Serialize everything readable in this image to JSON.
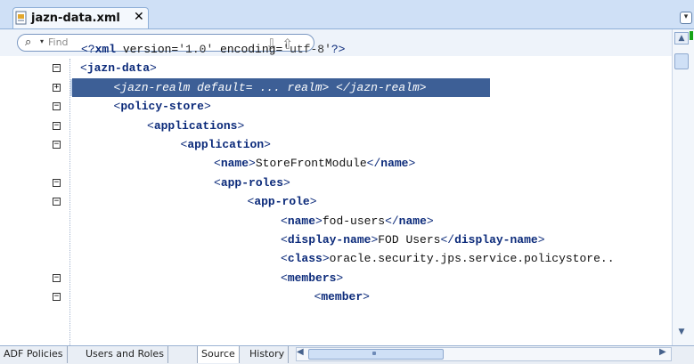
{
  "tab": {
    "title": "jazn-data.xml",
    "close": "✕",
    "file_icon": "xml-file-icon"
  },
  "search": {
    "placeholder": "Find",
    "binocular": "binoculars-icon"
  },
  "editor": {
    "lines": [
      {
        "fold": "",
        "parts": [
          [
            "pun",
            "<?"
          ],
          [
            "tag",
            "xml"
          ],
          [
            "val",
            " version="
          ],
          [
            "str",
            "'1.0'"
          ],
          [
            "val",
            " encoding="
          ],
          [
            "str",
            "'utf-8'"
          ],
          [
            "pun",
            "?>"
          ]
        ]
      },
      {
        "fold": "−",
        "parts": [
          [
            "pun",
            "<"
          ],
          [
            "tag",
            "jazn-data"
          ],
          [
            "pun",
            ">"
          ]
        ]
      },
      {
        "fold": "+",
        "parts": [
          [
            "hl",
            "<jazn-realm default= ... realm> </jazn-realm>"
          ]
        ]
      },
      {
        "fold": "−",
        "parts": [
          [
            "pun",
            "<"
          ],
          [
            "tag",
            "policy-store"
          ],
          [
            "pun",
            ">"
          ]
        ]
      },
      {
        "fold": "−",
        "parts": [
          [
            "pun",
            "<"
          ],
          [
            "tag",
            "applications"
          ],
          [
            "pun",
            ">"
          ]
        ]
      },
      {
        "fold": "−",
        "parts": [
          [
            "pun",
            "<"
          ],
          [
            "tag",
            "application"
          ],
          [
            "pun",
            ">"
          ]
        ]
      },
      {
        "fold": "",
        "parts": [
          [
            "pun",
            "<"
          ],
          [
            "tag",
            "name"
          ],
          [
            "pun",
            ">"
          ],
          [
            "val",
            "StoreFrontModule"
          ],
          [
            "pun",
            "</"
          ],
          [
            "tag",
            "name"
          ],
          [
            "pun",
            ">"
          ]
        ]
      },
      {
        "fold": "−",
        "parts": [
          [
            "pun",
            "<"
          ],
          [
            "tag",
            "app-roles"
          ],
          [
            "pun",
            ">"
          ]
        ]
      },
      {
        "fold": "−",
        "parts": [
          [
            "pun",
            "<"
          ],
          [
            "tag",
            "app-role"
          ],
          [
            "pun",
            ">"
          ]
        ]
      },
      {
        "fold": "",
        "parts": [
          [
            "pun",
            "<"
          ],
          [
            "tag",
            "name"
          ],
          [
            "pun",
            ">"
          ],
          [
            "val",
            "fod-users"
          ],
          [
            "pun",
            "</"
          ],
          [
            "tag",
            "name"
          ],
          [
            "pun",
            ">"
          ]
        ]
      },
      {
        "fold": "",
        "parts": [
          [
            "pun",
            "<"
          ],
          [
            "tag",
            "display-name"
          ],
          [
            "pun",
            ">"
          ],
          [
            "val",
            "FOD Users"
          ],
          [
            "pun",
            "</"
          ],
          [
            "tag",
            "display-name"
          ],
          [
            "pun",
            ">"
          ]
        ]
      },
      {
        "fold": "",
        "parts": [
          [
            "pun",
            "<"
          ],
          [
            "tag",
            "class"
          ],
          [
            "pun",
            ">"
          ],
          [
            "val",
            "oracle.security.jps.service.policystore.."
          ]
        ]
      },
      {
        "fold": "−",
        "parts": [
          [
            "pun",
            "<"
          ],
          [
            "tag",
            "members"
          ],
          [
            "pun",
            ">"
          ]
        ]
      },
      {
        "fold": "−",
        "parts": [
          [
            "pun",
            "<"
          ],
          [
            "tag",
            "member"
          ],
          [
            "pun",
            ">"
          ]
        ]
      }
    ]
  },
  "bottom_tabs": [
    "ADF Policies",
    "Users and Roles",
    "Source",
    "History"
  ],
  "active_bottom_tab": "Source"
}
